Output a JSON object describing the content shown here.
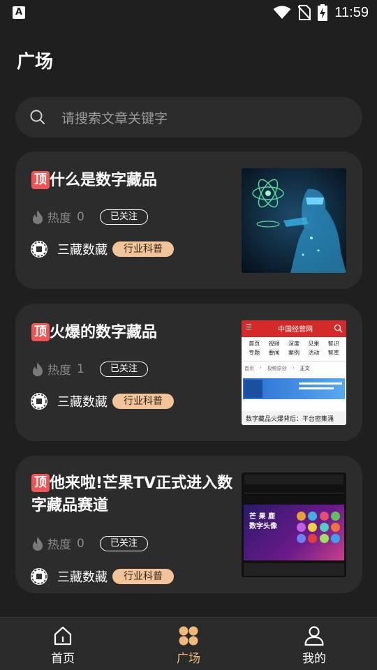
{
  "status_bar": {
    "time": "11:59"
  },
  "header": {
    "title": "广场"
  },
  "search": {
    "placeholder": "请搜索文章关键字"
  },
  "colors": {
    "accent": "#f0b87a",
    "top_badge": "#f05454",
    "tag_bg": "#f2c49a",
    "card_bg": "#2c2c2c",
    "background": "#1f1f1f"
  },
  "articles": [
    {
      "top_badge": "顶",
      "title": "什么是数字藏品",
      "heat_label": "热度",
      "heat_value": "0",
      "follow_label": "已关注",
      "author": "三藏数藏",
      "tag": "行业科普"
    },
    {
      "top_badge": "顶",
      "title": "火爆的数字藏品",
      "heat_label": "热度",
      "heat_value": "1",
      "follow_label": "已关注",
      "author": "三藏数藏",
      "tag": "行业科普",
      "thumb": {
        "site_title": "中国经营网",
        "nav": [
          "首页",
          "视频",
          "深度",
          "见果",
          "智识",
          "专题",
          "要闻",
          "案例",
          "活动",
          "智库"
        ],
        "breadcrumb": [
          "首页",
          "投统原创",
          "正文"
        ],
        "caption": "数字藏品火爆背后：平台密集涌"
      }
    },
    {
      "top_badge": "顶",
      "title": "他来啦!芒果TV正式进入数字藏品赛道",
      "heat_label": "热度",
      "heat_value": "0",
      "follow_label": "已关注",
      "author": "三藏数藏",
      "tag": "行业科普",
      "thumb": {
        "banner_line1": "芒 果 鹿",
        "banner_line2": "数字头像"
      }
    }
  ],
  "bottom_nav": {
    "items": [
      {
        "label": "首页",
        "icon": "home-icon",
        "active": false
      },
      {
        "label": "广场",
        "icon": "grid-icon",
        "active": true
      },
      {
        "label": "我的",
        "icon": "user-icon",
        "active": false
      }
    ]
  }
}
